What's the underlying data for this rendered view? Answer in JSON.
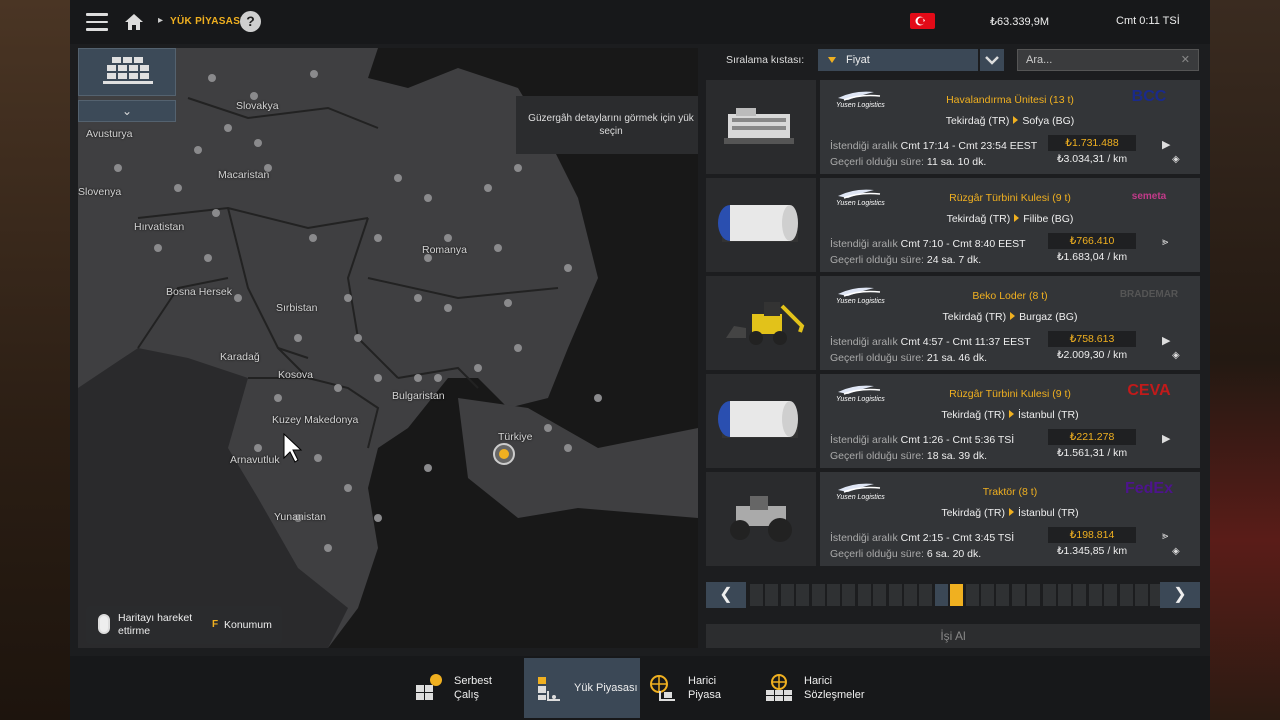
{
  "topbar": {
    "breadcrumb": "YÜK PİYASASI",
    "help": "?",
    "money": "₺63.339,9M",
    "time": "Cmt 0:11 TSİ"
  },
  "map": {
    "tooltip": "Güzergâh detaylarını görmek için yük seçin",
    "labels": [
      "Slovakya",
      "Avusturya",
      "Macaristan",
      "Slovenya",
      "Hırvatistan",
      "Romanya",
      "Bosna Hersek",
      "Sırbistan",
      "Karadağ",
      "Kosova",
      "Bulgaristan",
      "Kuzey Makedonya",
      "Türkiye",
      "Arnavutluk",
      "Yunanistan"
    ],
    "hint_move": "Haritayı hareket ettirme",
    "hint_key": "F",
    "hint_pos": "Konumum"
  },
  "panel": {
    "sort_label": "Sıralama kıstası:",
    "sort_value": "Fiyat",
    "search_placeholder": "Ara...",
    "accept": "İşi Al",
    "jobs": [
      {
        "sender": "Yusen Logistics",
        "cargo": "Havalandırma Ünitesi (13 t)",
        "from": "Tekirdağ (TR)",
        "to": "Sofya (BG)",
        "interval_label": "İstendiği aralık",
        "interval": "Cmt 17:14 - Cmt 23:54 EEST",
        "valid_label": "Geçerli olduğu süre:",
        "valid": "11 sa. 10 dk.",
        "price": "₺1.731.488",
        "per_km": "₺3.034,31 / km",
        "company": "BCC",
        "company_color": "#1a2a8a"
      },
      {
        "sender": "Yusen Logistics",
        "cargo": "Rüzgâr Türbini Kulesi (9 t)",
        "from": "Tekirdağ (TR)",
        "to": "Filibe (BG)",
        "interval_label": "İstendiği aralık",
        "interval": "Cmt 7:10 - Cmt 8:40 EEST",
        "valid_label": "Geçerli olduğu süre:",
        "valid": "24 sa. 7 dk.",
        "price": "₺766.410",
        "per_km": "₺1.683,04 / km",
        "company": "semeta",
        "company_color": "#c23a8a"
      },
      {
        "sender": "Yusen Logistics",
        "cargo": "Beko Loder (8 t)",
        "from": "Tekirdağ (TR)",
        "to": "Burgaz (BG)",
        "interval_label": "İstendiği aralık",
        "interval": "Cmt 4:57 - Cmt 11:37 EEST",
        "valid_label": "Geçerli olduğu süre:",
        "valid": "21 sa. 46 dk.",
        "price": "₺758.613",
        "per_km": "₺2.009,30 / km",
        "company": "BRADEMAR",
        "company_color": "#555555"
      },
      {
        "sender": "Yusen Logistics",
        "cargo": "Rüzgâr Türbini Kulesi (9 t)",
        "from": "Tekirdağ (TR)",
        "to": "İstanbul (TR)",
        "interval_label": "İstendiği aralık",
        "interval": "Cmt 1:26 - Cmt 5:36 TSİ",
        "valid_label": "Geçerli olduğu süre:",
        "valid": "18 sa. 39 dk.",
        "price": "₺221.278",
        "per_km": "₺1.561,31 / km",
        "company": "CEVA",
        "company_color": "#c21a1a"
      },
      {
        "sender": "Yusen Logistics",
        "cargo": "Traktör (8 t)",
        "from": "Tekirdağ (TR)",
        "to": "İstanbul (TR)",
        "interval_label": "İstendiği aralık",
        "interval": "Cmt 2:15 - Cmt 3:45 TSİ",
        "valid_label": "Geçerli olduğu süre:",
        "valid": "6 sa. 20 dk.",
        "price": "₺198.814",
        "per_km": "₺1.345,85 / km",
        "company": "FedEx",
        "company_color": "#4d148c"
      }
    ]
  },
  "bottom": {
    "tabs": [
      "Serbest Çalış",
      "Yük Piyasası",
      "Harici Piyasa",
      "Harici Sözleşmeler"
    ]
  },
  "colors": {
    "accent": "#f0b020",
    "selected": "#3b4856"
  }
}
